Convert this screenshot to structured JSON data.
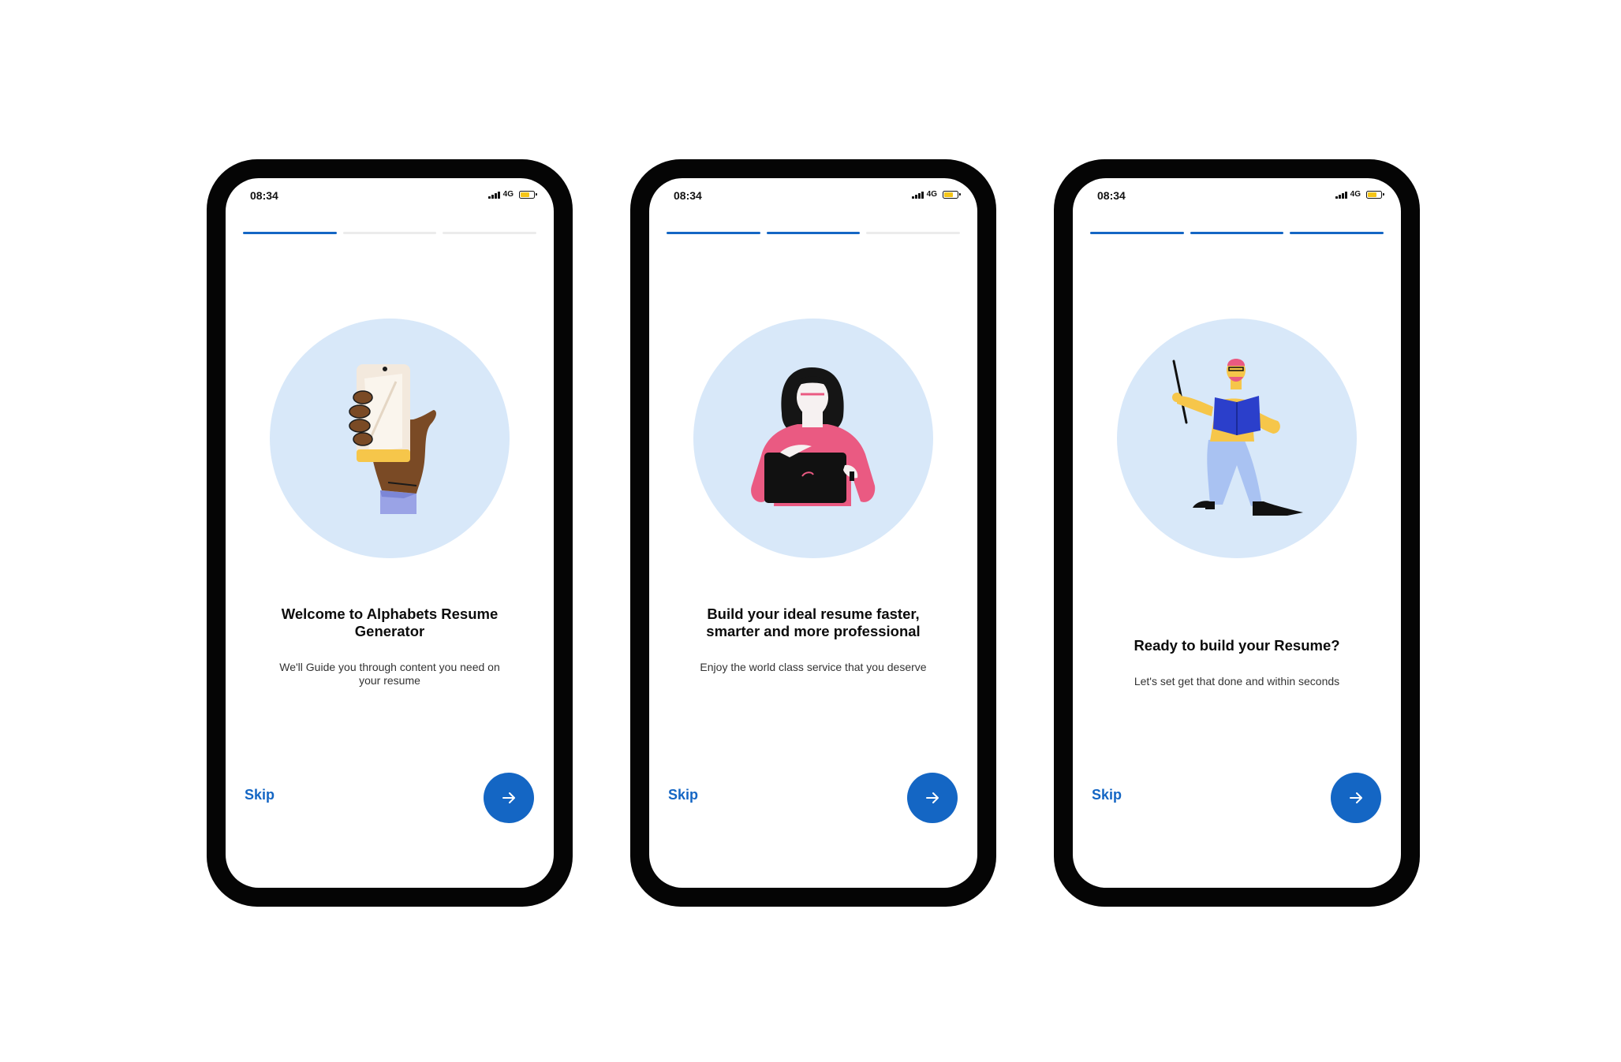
{
  "colors": {
    "accent": "#1466c4",
    "circle": "#d8e8f9",
    "frame": "#050505"
  },
  "screens": [
    {
      "time": "08:34",
      "network": "4G",
      "progress": {
        "active": 1,
        "total": 3
      },
      "illustration": "hand-holding-phone-illustration",
      "title": "Welcome to Alphabets Resume Generator",
      "subtitle": "We'll Guide you through content you need on your resume",
      "skip_label": "Skip",
      "next_icon": "arrow-right-icon"
    },
    {
      "time": "08:34",
      "network": "4G",
      "progress": {
        "active": 2,
        "total": 3
      },
      "illustration": "woman-with-laptop-illustration",
      "title": "Build your ideal resume faster, smarter and more professional",
      "subtitle": "Enjoy the world class service that you deserve",
      "skip_label": "Skip",
      "next_icon": "arrow-right-icon"
    },
    {
      "time": "08:34",
      "network": "4G",
      "progress": {
        "active": 3,
        "total": 3
      },
      "illustration": "man-with-book-and-pointer-illustration",
      "title": "Ready to build your Resume?",
      "subtitle": "Let's set get that done and within seconds",
      "skip_label": "Skip",
      "next_icon": "arrow-right-icon"
    }
  ]
}
